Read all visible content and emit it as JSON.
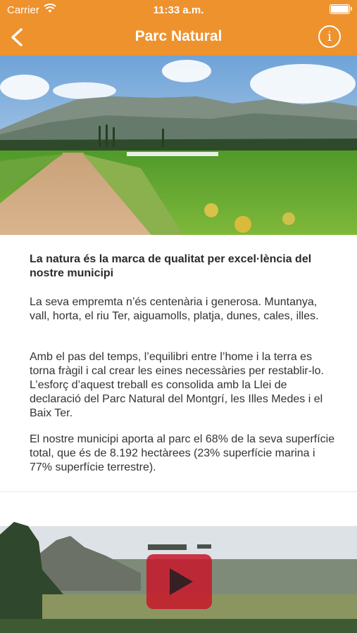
{
  "status_bar": {
    "carrier": "Carrier",
    "time": "11:33 a.m."
  },
  "navbar": {
    "title": "Parc Natural",
    "back_icon": "chevron-left-icon",
    "info_icon": "info-icon",
    "info_glyph": "i"
  },
  "content": {
    "heading": "La natura és la marca de qualitat per excel·lència del nostre municipi",
    "paragraphs": [
      "La seva empremta n’és centenària i generosa. Muntanya, vall, horta, el riu Ter, aiguamolls, platja, dunes, cales, illes.",
      "Amb el pas del temps, l’equilibri entre l’home i la terra es torna fràgil i cal crear les eines necessàries per restablir-lo. L’esforç d’aquest treball es consolida amb la Llei de declaració del Parc Natural del Montgrí, les Illes Medes i el Baix Ter.",
      "El nostre municipi aporta al parc el 68% de la seva superfície total, que és de 8.192 hectàrees (23% superfície marina i 77% superfície terrestre)."
    ]
  },
  "video": {
    "play_icon": "play-icon"
  },
  "colors": {
    "accent": "#ee922e",
    "play_button": "#c8162a"
  }
}
